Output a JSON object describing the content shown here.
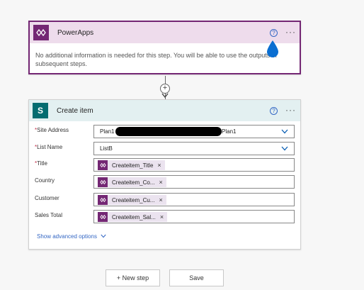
{
  "powerapps": {
    "title": "PowerApps",
    "help": "?",
    "menu": "···",
    "message": "No additional information is needed for this step. You will be able to use the outputs in subsequent steps."
  },
  "connector": {
    "plus": "+"
  },
  "create_item": {
    "title": "Create item",
    "icon_letter": "S",
    "help": "?",
    "menu": "···",
    "fields": {
      "site_address": {
        "required": "*",
        "label": "Site Address",
        "value_start": "Plan1",
        "value_end": "Plan1"
      },
      "list_name": {
        "required": "*",
        "label": "List Name",
        "value": "ListB"
      },
      "title": {
        "required": "*",
        "label": "Title",
        "token": "Createitem_Title",
        "remove": "×"
      },
      "country": {
        "label": "Country",
        "token": "Createitem_Co...",
        "remove": "×"
      },
      "customer": {
        "label": "Customer",
        "token": "Createitem_Cu...",
        "remove": "×"
      },
      "sales_total": {
        "label": "Sales Total",
        "token": "Createitem_Sal...",
        "remove": "×"
      }
    },
    "advanced": "Show advanced options"
  },
  "footer": {
    "new_step": "+ New step",
    "save": "Save"
  },
  "icons": [
    "powerapps-icon",
    "help-icon",
    "more-icon",
    "sharepoint-icon",
    "chevron-down-icon",
    "token-icon",
    "arrow-down-icon"
  ],
  "colors": {
    "powerapps": "#742774",
    "sharepoint": "#036c70",
    "link": "#3467c4",
    "required": "#c4314b"
  }
}
